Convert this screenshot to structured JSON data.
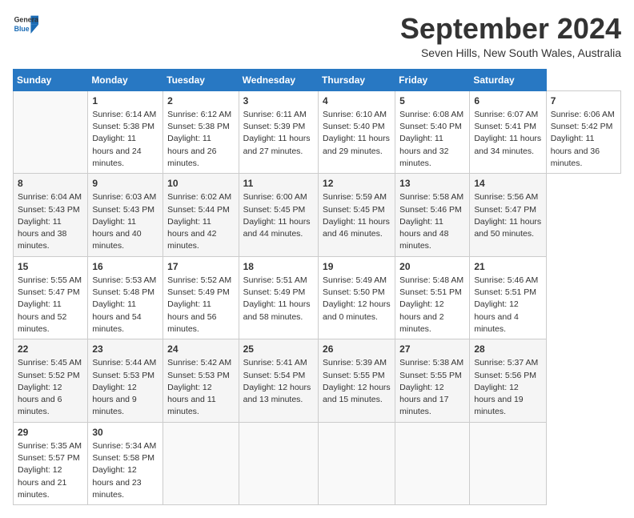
{
  "header": {
    "logo_general": "General",
    "logo_blue": "Blue",
    "title": "September 2024",
    "location": "Seven Hills, New South Wales, Australia"
  },
  "calendar": {
    "days_of_week": [
      "Sunday",
      "Monday",
      "Tuesday",
      "Wednesday",
      "Thursday",
      "Friday",
      "Saturday"
    ],
    "weeks": [
      [
        null,
        {
          "day": "1",
          "sunrise": "Sunrise: 6:14 AM",
          "sunset": "Sunset: 5:38 PM",
          "daylight": "Daylight: 11 hours and 24 minutes."
        },
        {
          "day": "2",
          "sunrise": "Sunrise: 6:12 AM",
          "sunset": "Sunset: 5:38 PM",
          "daylight": "Daylight: 11 hours and 26 minutes."
        },
        {
          "day": "3",
          "sunrise": "Sunrise: 6:11 AM",
          "sunset": "Sunset: 5:39 PM",
          "daylight": "Daylight: 11 hours and 27 minutes."
        },
        {
          "day": "4",
          "sunrise": "Sunrise: 6:10 AM",
          "sunset": "Sunset: 5:40 PM",
          "daylight": "Daylight: 11 hours and 29 minutes."
        },
        {
          "day": "5",
          "sunrise": "Sunrise: 6:08 AM",
          "sunset": "Sunset: 5:40 PM",
          "daylight": "Daylight: 11 hours and 32 minutes."
        },
        {
          "day": "6",
          "sunrise": "Sunrise: 6:07 AM",
          "sunset": "Sunset: 5:41 PM",
          "daylight": "Daylight: 11 hours and 34 minutes."
        },
        {
          "day": "7",
          "sunrise": "Sunrise: 6:06 AM",
          "sunset": "Sunset: 5:42 PM",
          "daylight": "Daylight: 11 hours and 36 minutes."
        }
      ],
      [
        {
          "day": "8",
          "sunrise": "Sunrise: 6:04 AM",
          "sunset": "Sunset: 5:43 PM",
          "daylight": "Daylight: 11 hours and 38 minutes."
        },
        {
          "day": "9",
          "sunrise": "Sunrise: 6:03 AM",
          "sunset": "Sunset: 5:43 PM",
          "daylight": "Daylight: 11 hours and 40 minutes."
        },
        {
          "day": "10",
          "sunrise": "Sunrise: 6:02 AM",
          "sunset": "Sunset: 5:44 PM",
          "daylight": "Daylight: 11 hours and 42 minutes."
        },
        {
          "day": "11",
          "sunrise": "Sunrise: 6:00 AM",
          "sunset": "Sunset: 5:45 PM",
          "daylight": "Daylight: 11 hours and 44 minutes."
        },
        {
          "day": "12",
          "sunrise": "Sunrise: 5:59 AM",
          "sunset": "Sunset: 5:45 PM",
          "daylight": "Daylight: 11 hours and 46 minutes."
        },
        {
          "day": "13",
          "sunrise": "Sunrise: 5:58 AM",
          "sunset": "Sunset: 5:46 PM",
          "daylight": "Daylight: 11 hours and 48 minutes."
        },
        {
          "day": "14",
          "sunrise": "Sunrise: 5:56 AM",
          "sunset": "Sunset: 5:47 PM",
          "daylight": "Daylight: 11 hours and 50 minutes."
        }
      ],
      [
        {
          "day": "15",
          "sunrise": "Sunrise: 5:55 AM",
          "sunset": "Sunset: 5:47 PM",
          "daylight": "Daylight: 11 hours and 52 minutes."
        },
        {
          "day": "16",
          "sunrise": "Sunrise: 5:53 AM",
          "sunset": "Sunset: 5:48 PM",
          "daylight": "Daylight: 11 hours and 54 minutes."
        },
        {
          "day": "17",
          "sunrise": "Sunrise: 5:52 AM",
          "sunset": "Sunset: 5:49 PM",
          "daylight": "Daylight: 11 hours and 56 minutes."
        },
        {
          "day": "18",
          "sunrise": "Sunrise: 5:51 AM",
          "sunset": "Sunset: 5:49 PM",
          "daylight": "Daylight: 11 hours and 58 minutes."
        },
        {
          "day": "19",
          "sunrise": "Sunrise: 5:49 AM",
          "sunset": "Sunset: 5:50 PM",
          "daylight": "Daylight: 12 hours and 0 minutes."
        },
        {
          "day": "20",
          "sunrise": "Sunrise: 5:48 AM",
          "sunset": "Sunset: 5:51 PM",
          "daylight": "Daylight: 12 hours and 2 minutes."
        },
        {
          "day": "21",
          "sunrise": "Sunrise: 5:46 AM",
          "sunset": "Sunset: 5:51 PM",
          "daylight": "Daylight: 12 hours and 4 minutes."
        }
      ],
      [
        {
          "day": "22",
          "sunrise": "Sunrise: 5:45 AM",
          "sunset": "Sunset: 5:52 PM",
          "daylight": "Daylight: 12 hours and 6 minutes."
        },
        {
          "day": "23",
          "sunrise": "Sunrise: 5:44 AM",
          "sunset": "Sunset: 5:53 PM",
          "daylight": "Daylight: 12 hours and 9 minutes."
        },
        {
          "day": "24",
          "sunrise": "Sunrise: 5:42 AM",
          "sunset": "Sunset: 5:53 PM",
          "daylight": "Daylight: 12 hours and 11 minutes."
        },
        {
          "day": "25",
          "sunrise": "Sunrise: 5:41 AM",
          "sunset": "Sunset: 5:54 PM",
          "daylight": "Daylight: 12 hours and 13 minutes."
        },
        {
          "day": "26",
          "sunrise": "Sunrise: 5:39 AM",
          "sunset": "Sunset: 5:55 PM",
          "daylight": "Daylight: 12 hours and 15 minutes."
        },
        {
          "day": "27",
          "sunrise": "Sunrise: 5:38 AM",
          "sunset": "Sunset: 5:55 PM",
          "daylight": "Daylight: 12 hours and 17 minutes."
        },
        {
          "day": "28",
          "sunrise": "Sunrise: 5:37 AM",
          "sunset": "Sunset: 5:56 PM",
          "daylight": "Daylight: 12 hours and 19 minutes."
        }
      ],
      [
        {
          "day": "29",
          "sunrise": "Sunrise: 5:35 AM",
          "sunset": "Sunset: 5:57 PM",
          "daylight": "Daylight: 12 hours and 21 minutes."
        },
        {
          "day": "30",
          "sunrise": "Sunrise: 5:34 AM",
          "sunset": "Sunset: 5:58 PM",
          "daylight": "Daylight: 12 hours and 23 minutes."
        },
        null,
        null,
        null,
        null,
        null
      ]
    ]
  }
}
